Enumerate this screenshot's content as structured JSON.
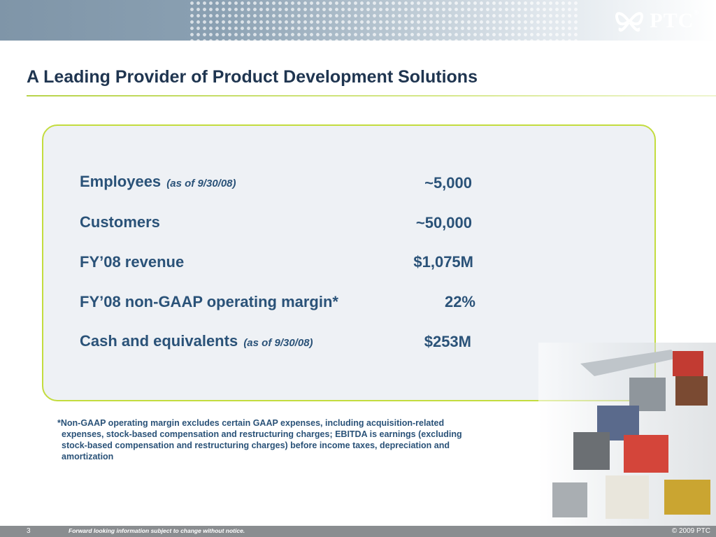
{
  "brand": {
    "logo_text": "PTC",
    "reg_mark": "®",
    "accent_color": "#c3dc3e",
    "text_color": "#2a5278",
    "title_color": "#1f3550"
  },
  "slide": {
    "title": "A Leading Provider of Product Development Solutions"
  },
  "stats": [
    {
      "label": "Employees",
      "note": "(as of 9/30/08)",
      "value": "~5,000"
    },
    {
      "label": "Customers",
      "note": "",
      "value": "~50,000"
    },
    {
      "label": "FY’08 revenue",
      "note": "",
      "value": "$1,075M"
    },
    {
      "label": "FY’08 non-GAAP operating margin*",
      "note": "",
      "value": "22%"
    },
    {
      "label": "Cash and equivalents",
      "note": "(as of 9/30/08)",
      "value": "$253M"
    }
  ],
  "footnote": "*Non-GAAP operating margin excludes certain GAAP expenses, including acquisition-related expenses, stock-based compensation and restructuring charges; EBITDA is earnings (excluding stock-based compensation and restructuring charges) before income taxes, depreciation and amortization",
  "footer": {
    "page_number": "3",
    "disclaimer": "Forward looking information subject to change without notice.",
    "copyright": "© 2009 PTC"
  }
}
